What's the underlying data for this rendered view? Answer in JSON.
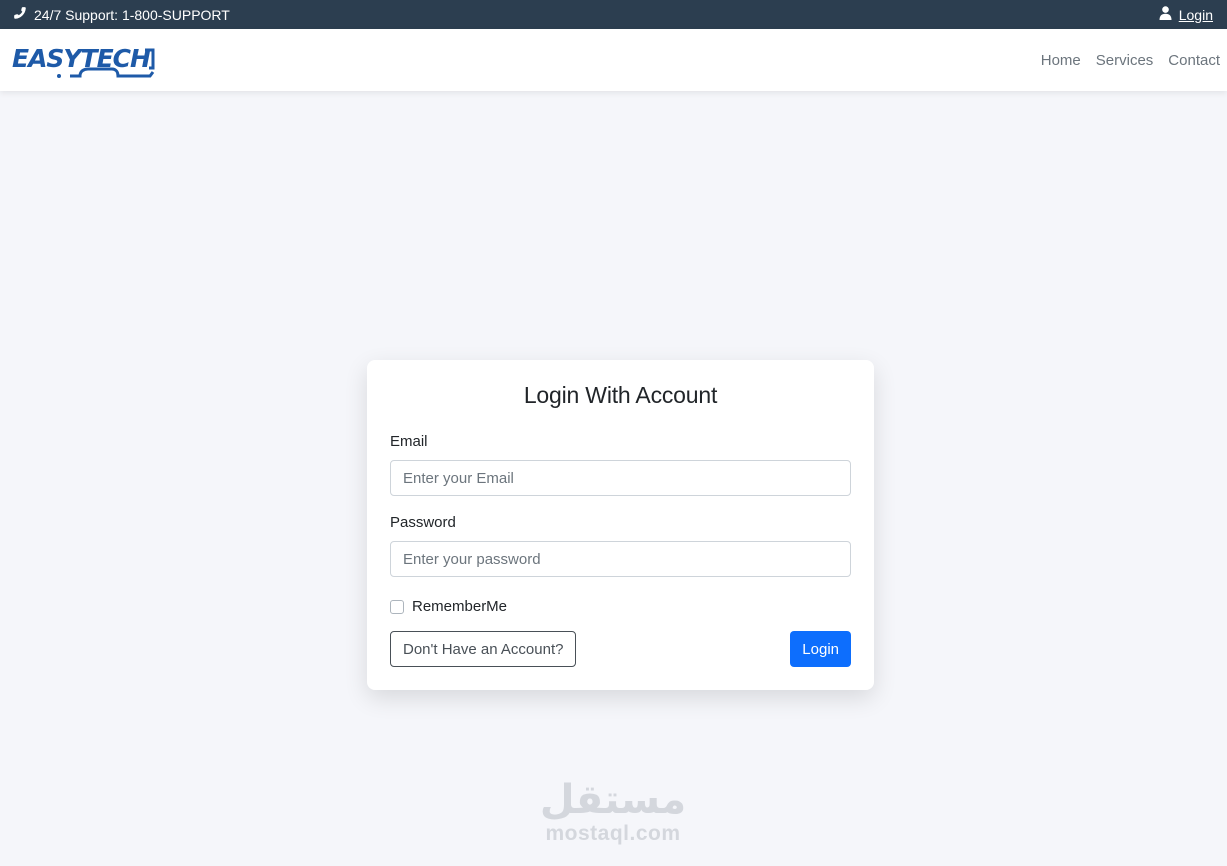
{
  "topbar": {
    "support_icon": "phone-icon",
    "support_text": "24/7 Support: 1-800-SUPPORT",
    "login_icon": "user-icon",
    "login_label": "Login"
  },
  "navbar": {
    "logo_text": "EASYTECH",
    "links": [
      {
        "label": "Home"
      },
      {
        "label": "Services"
      },
      {
        "label": "Contact"
      }
    ]
  },
  "login_card": {
    "title": "Login With Account",
    "email_label": "Email",
    "email_placeholder": "Enter your Email",
    "password_label": "Password",
    "password_placeholder": "Enter your password",
    "remember_label": "RememberMe",
    "register_button": "Don't Have an Account?",
    "login_button": "Login"
  },
  "watermark": {
    "arabic": "مستقل",
    "latin": "mostaql.com"
  },
  "colors": {
    "topbar_bg": "#2c3e50",
    "logo_blue": "#1e5aa8",
    "primary": "#0d6efd",
    "page_bg": "#f5f6fa"
  }
}
